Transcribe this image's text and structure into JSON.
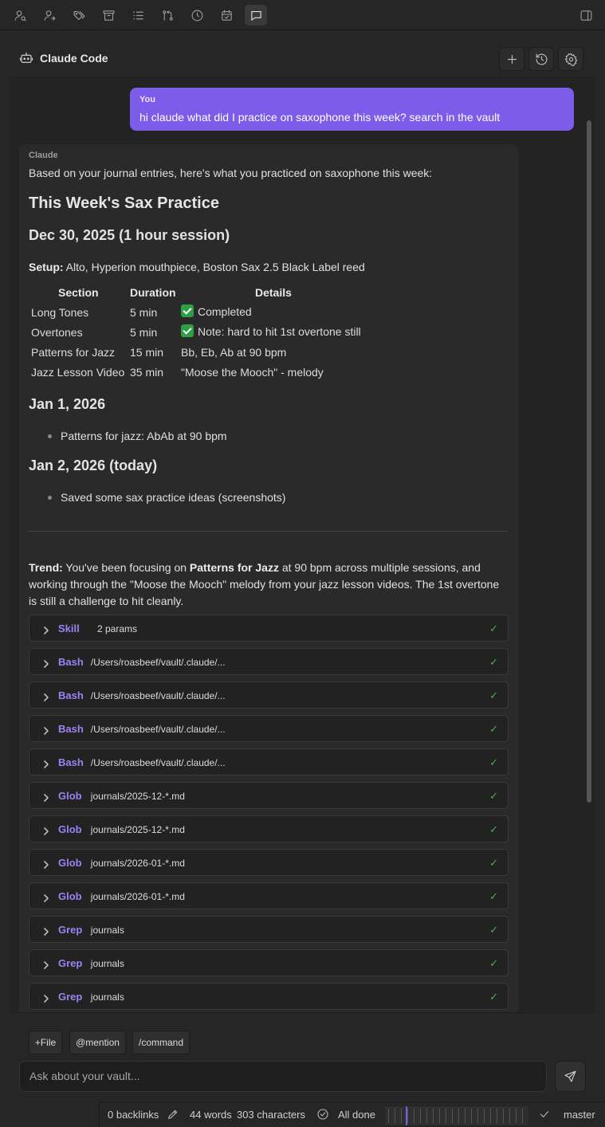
{
  "toolbar": {
    "icons": [
      "person-search-icon",
      "share-link-icon",
      "tags-icon",
      "archive-icon",
      "list-icon",
      "git-compare-icon",
      "clock-icon",
      "calendar-check-icon",
      "chat-icon",
      "sidebar-toggle-icon"
    ],
    "active": "chat-icon"
  },
  "panel": {
    "title": "Claude Code",
    "buttons": [
      "new-chat-icon",
      "history-icon",
      "settings-icon"
    ]
  },
  "user_message": {
    "label": "You",
    "text": "hi claude what did I practice on saxophone this week? search in the vault"
  },
  "claude_message": {
    "label": "Claude",
    "intro": "Based on your journal entries, here's what you practiced on saxophone this week:",
    "heading": "This Week's Sax Practice",
    "section1_title": "Dec 30, 2025 (1 hour session)",
    "setup_label": "Setup:",
    "setup_text": " Alto, Hyperion mouthpiece, Boston Sax 2.5 Black Label reed",
    "table": {
      "headers": [
        "Section",
        "Duration",
        "Details"
      ],
      "rows": [
        [
          "Long Tones",
          "5 min",
          "Completed"
        ],
        [
          "Overtones",
          "5 min",
          "Note: hard to hit 1st overtone still"
        ],
        [
          "Patterns for Jazz",
          "15 min",
          "Bb, Eb, Ab at 90 bpm"
        ],
        [
          "Jazz Lesson Video",
          "35 min",
          "\"Moose the Mooch\" - melody"
        ]
      ]
    },
    "section2_title": "Jan 1, 2026",
    "section2_bullet": "Patterns for jazz: AbAb at 90 bpm",
    "section3_title": "Jan 2, 2026 (today)",
    "section3_bullet": "Saved some sax practice ideas (screenshots)",
    "trend_label": "Trend:",
    "trend_1": " You've been focusing on ",
    "trend_bold": "Patterns for Jazz",
    "trend_2": " at 90 bpm across multiple sessions, and working through the \"Moose the Mooch\" melody from your jazz lesson videos. The 1st overtone is still a challenge to hit cleanly.",
    "tool_calls": [
      {
        "name": "Skill",
        "param": "2 params",
        "status": "✓"
      },
      {
        "name": "Bash",
        "param": "/Users/roasbeef/vault/.claude/...",
        "status": "✓"
      },
      {
        "name": "Bash",
        "param": "/Users/roasbeef/vault/.claude/...",
        "status": "✓"
      },
      {
        "name": "Bash",
        "param": "/Users/roasbeef/vault/.claude/...",
        "status": "✓"
      },
      {
        "name": "Bash",
        "param": "/Users/roasbeef/vault/.claude/...",
        "status": "✓"
      },
      {
        "name": "Glob",
        "param": "journals/2025-12-*.md",
        "status": "✓"
      },
      {
        "name": "Glob",
        "param": "journals/2025-12-*.md",
        "status": "✓"
      },
      {
        "name": "Glob",
        "param": "journals/2026-01-*.md",
        "status": "✓"
      },
      {
        "name": "Glob",
        "param": "journals/2026-01-*.md",
        "status": "✓"
      },
      {
        "name": "Grep",
        "param": "journals",
        "status": "✓"
      },
      {
        "name": "Grep",
        "param": "journals",
        "status": "✓"
      },
      {
        "name": "Grep",
        "param": "journals",
        "status": "✓"
      }
    ]
  },
  "composer": {
    "chips": [
      "+File",
      "@mention",
      "/command"
    ],
    "placeholder": "Ask about your vault..."
  },
  "status_bar": {
    "backlinks": "0 backlinks",
    "words": "44 words",
    "characters": "303 characters",
    "sync": "All done",
    "branch": "master"
  },
  "colors": {
    "accent": "#7c5ce8",
    "tool_name": "#9d82f5",
    "success": "#4caf50"
  }
}
